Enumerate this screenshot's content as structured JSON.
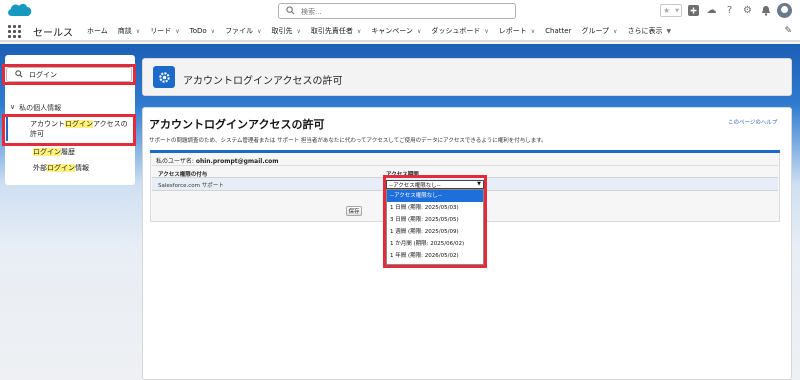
{
  "header": {
    "search_placeholder": "検索...",
    "icons": [
      "star-icon",
      "add-icon",
      "cloud-icon",
      "help-icon",
      "gear-icon",
      "bell-icon",
      "avatar"
    ]
  },
  "nav": {
    "app_name": "セールス",
    "items": [
      {
        "label": "ホーム",
        "dropdown": false
      },
      {
        "label": "商談",
        "dropdown": true
      },
      {
        "label": "リード",
        "dropdown": true
      },
      {
        "label": "ToDo",
        "dropdown": true
      },
      {
        "label": "ファイル",
        "dropdown": true
      },
      {
        "label": "取引先",
        "dropdown": true
      },
      {
        "label": "取引先責任者",
        "dropdown": true
      },
      {
        "label": "キャンペーン",
        "dropdown": true
      },
      {
        "label": "ダッシュボード",
        "dropdown": true
      },
      {
        "label": "レポート",
        "dropdown": true
      },
      {
        "label": "Chatter",
        "dropdown": false
      },
      {
        "label": "グループ",
        "dropdown": true
      },
      {
        "label": "さらに表示",
        "dropdown": true
      }
    ]
  },
  "sidebar": {
    "quick_find_value": "ログイン",
    "section": "私の個人情報",
    "items": [
      {
        "pre": "アカウント",
        "hl": "ログイン",
        "post": "アクセスの許可"
      },
      {
        "pre": "",
        "hl": "ログイン",
        "post": "履歴"
      },
      {
        "pre": "外部",
        "hl": "ログイン",
        "post": "情報"
      }
    ]
  },
  "page": {
    "header_title": "アカウントログインアクセスの許可",
    "title": "アカウントログインアクセスの許可",
    "help_link": "このページのヘルプ",
    "description": "サポートの問題調査のため、システム管理者または サポート 担当者があなたに代わってアクセスしてご使用のデータにアクセスできるように権利を付与します。",
    "user_label": "私のユーザ名:",
    "user_value": "ohin.prompt@gmail.com",
    "col_grantee": "アクセス権限の付与",
    "col_duration": "アクセス期間",
    "row_name": "Salesforce.com サポート",
    "save_label": "保存",
    "select_value": "--アクセス権限なし--",
    "options": [
      "--アクセス権限なし--",
      "1 日間 (期限: 2025/05/03)",
      "3 日間 (期限: 2025/05/05)",
      "1 週間 (期限: 2025/05/09)",
      "1 か月間 (期限: 2025/06/02)",
      "1 年間 (期限: 2026/05/02)"
    ],
    "selected_option_index": 0
  },
  "colors": {
    "brand_blue": "#1b6ac9",
    "highlight_red": "#e32b3c",
    "highlight_yellow": "#fff27a"
  }
}
